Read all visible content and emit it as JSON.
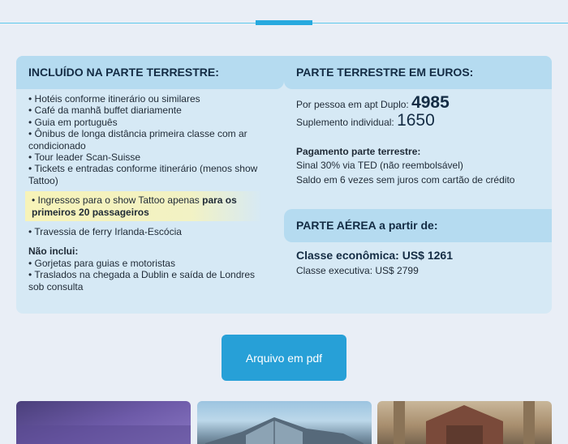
{
  "included": {
    "title": "INCLUÍDO NA PARTE TERRESTRE:",
    "items": [
      "• Hotéis conforme itinerário ou similares",
      "• Café da manhã buffet diariamente",
      "• Guia em português",
      "• Ônibus de longa distância primeira classe com ar condicionado",
      "• Tour leader Scan-Suisse",
      "• Tickets e entradas conforme itinerário (menos show Tattoo)"
    ],
    "highlight_normal": "• Ingressos para o show Tattoo apenas ",
    "highlight_bold": "para os primeiros 20 passageiros",
    "after_highlight": "• Travessia de ferry Irlanda-Escócia",
    "not_included_title": "Não inclui:",
    "not_included_items": [
      "• Gorjetas para guias e motoristas",
      "• Traslados na chegada a Dublin e saída de Londres sob consulta"
    ]
  },
  "euros": {
    "title": "PARTE TERRESTRE EM EUROS:",
    "double_label": "Por pessoa em apt Duplo: ",
    "double_value": "4985",
    "single_label": "Suplemento individual: ",
    "single_value": "1650",
    "payment_title": "Pagamento parte terrestre:",
    "payment_lines": [
      "Sinal 30% via TED (não reembolsável)",
      "Saldo em 6 vezes sem juros com cartão de crédito"
    ]
  },
  "air": {
    "title": "PARTE AÉREA a partir de:",
    "economy": "Classe econômica: US$ 1261",
    "executive": "Classe executiva: US$ 2799"
  },
  "pdf_button": "Arquivo em pdf"
}
